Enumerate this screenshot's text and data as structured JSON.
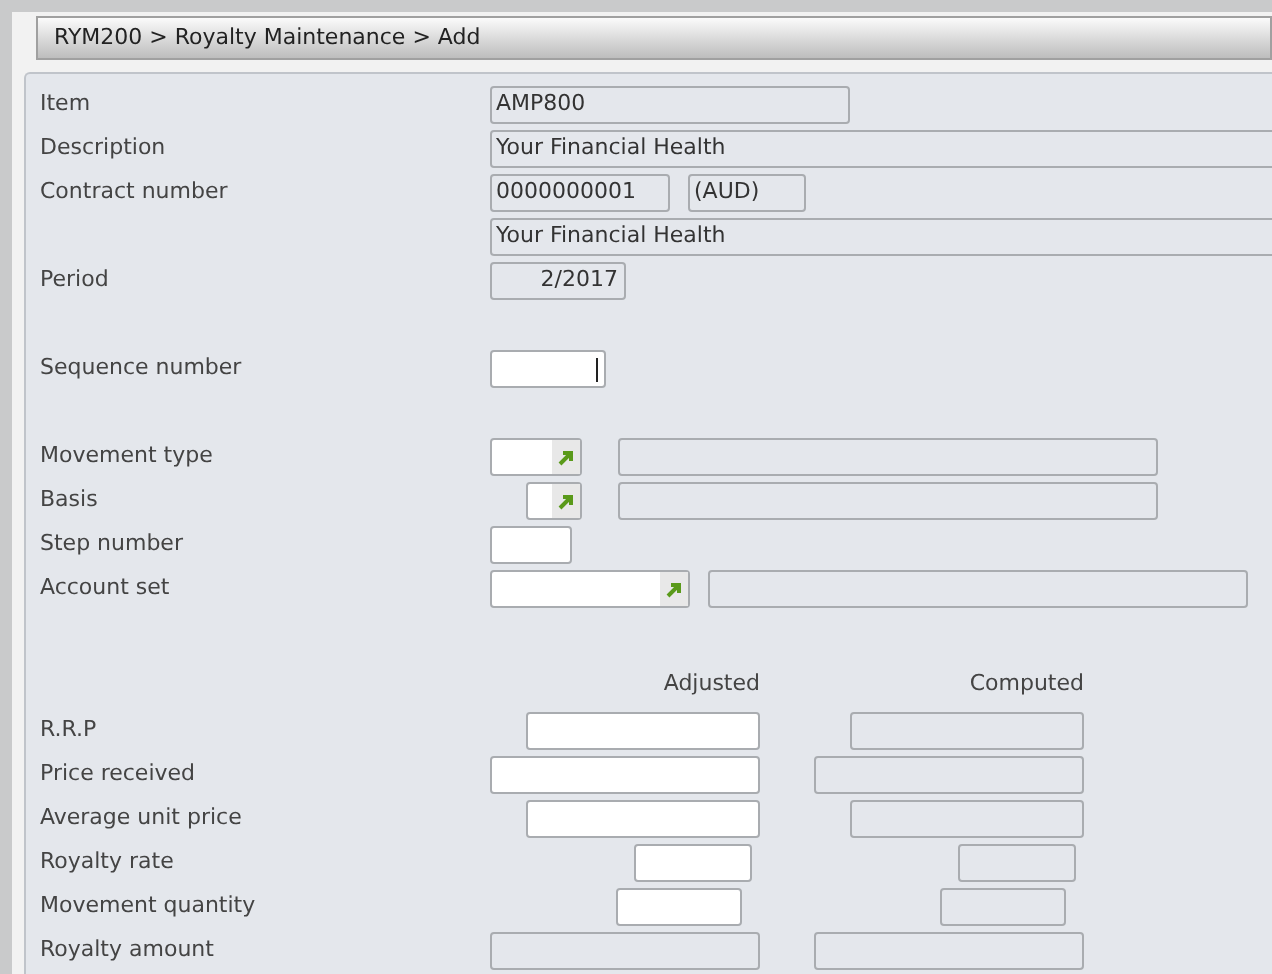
{
  "breadcrumb": "RYM200 > Royalty Maintenance > Add",
  "sections": [
    [
      {
        "label": "Item",
        "fields": [
          {
            "value": "AMP800",
            "disabled": true
          }
        ]
      },
      {
        "label": "Description",
        "fields": [
          {
            "value": "Your Financial Health",
            "disabled": true
          }
        ]
      },
      {
        "label": "Contract number",
        "fields": [
          {
            "value": "0000000001",
            "disabled": true
          },
          {
            "value": "(AUD)",
            "disabled": true
          }
        ]
      },
      {
        "fields": [
          {
            "value": "Your Financial Health",
            "disabled": true
          }
        ]
      },
      {
        "label": "Period",
        "fields": [
          {
            "value": "2/2017",
            "disabled": true
          }
        ]
      }
    ],
    [
      {
        "label": "Sequence number",
        "fields": [
          {
            "disabled": false,
            "focused": true
          }
        ]
      }
    ],
    [
      {
        "label": "Movement type",
        "fields": [
          {
            "disabled": false,
            "lookup": true
          },
          {
            "disabled": true
          }
        ]
      },
      {
        "label": "Basis",
        "fields": [
          {
            "disabled": false,
            "lookup": true
          },
          {
            "disabled": true
          }
        ]
      },
      {
        "label": "Step number",
        "fields": [
          {
            "disabled": false
          }
        ]
      },
      {
        "label": "Account set",
        "fields": [
          {
            "disabled": false,
            "lookup": true
          },
          {
            "disabled": true
          }
        ]
      }
    ]
  ],
  "amounts": {
    "columns": [
      "Adjusted",
      "Computed"
    ],
    "rows": [
      {
        "label": "R.R.P",
        "adjusted": {
          "disabled": false
        },
        "computed": {
          "disabled": true
        }
      },
      {
        "label": "Price received",
        "adjusted": {
          "disabled": false
        },
        "computed": {
          "disabled": true
        }
      },
      {
        "label": "Average unit price",
        "adjusted": {
          "disabled": false
        },
        "computed": {
          "disabled": true
        }
      },
      {
        "label": "Royalty rate",
        "adjusted": {
          "disabled": false
        },
        "computed": {
          "disabled": true
        }
      },
      {
        "label": "Movement quantity",
        "adjusted": {
          "disabled": false
        },
        "computed": {
          "disabled": true
        }
      },
      {
        "label": "Royalty amount",
        "adjusted": {
          "disabled": true
        },
        "computed": {
          "disabled": true
        }
      }
    ]
  }
}
